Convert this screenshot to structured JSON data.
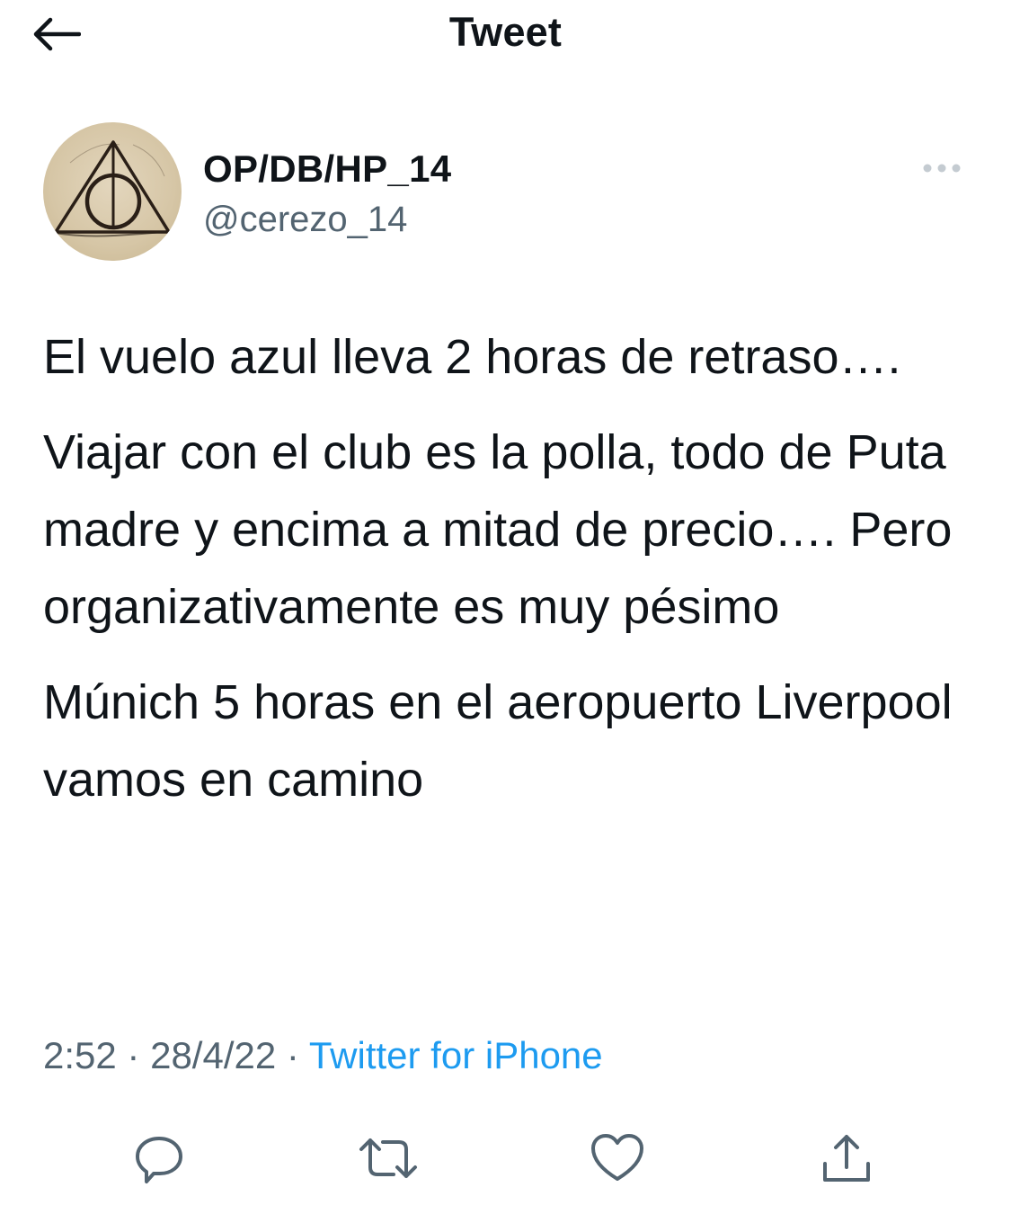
{
  "header": {
    "title": "Tweet",
    "back_icon": "arrow-left-icon"
  },
  "author": {
    "display_name": "OP/DB/HP_14",
    "handle": "@cerezo_14",
    "avatar_icon": "deathly-hallows-avatar",
    "more_icon": "more-horizontal-icon"
  },
  "tweet": {
    "paragraphs": [
      "El vuelo azul lleva 2 horas de retraso….",
      "Viajar con el club es la polla, todo de Puta madre y encima a mitad de precio…. Pero organizativamente es muy pésimo",
      "Múnich 5 horas en el aeropuerto Liverpool vamos en camino"
    ]
  },
  "meta": {
    "time": "2:52",
    "separator": "·",
    "date": "28/4/22",
    "source": "Twitter for iPhone"
  },
  "actions": {
    "reply_icon": "reply-icon",
    "retweet_icon": "retweet-icon",
    "like_icon": "heart-icon",
    "share_icon": "share-icon"
  },
  "colors": {
    "text": "#0f1419",
    "secondary": "#536471",
    "accent": "#1d9bf0",
    "background": "#ffffff"
  }
}
